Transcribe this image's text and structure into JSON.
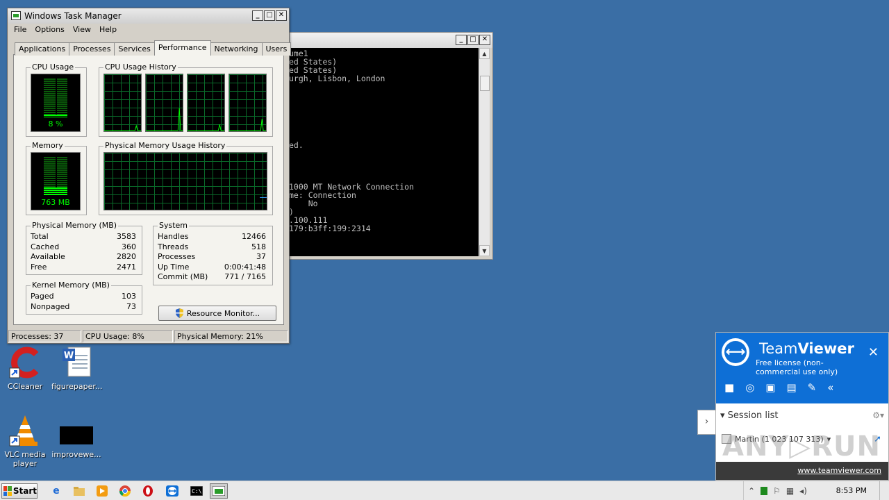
{
  "desktop": {
    "icons": [
      {
        "label": "CCleaner"
      },
      {
        "label": "figurepaper..."
      },
      {
        "label": "VLC media player"
      },
      {
        "label": "improvewe..."
      }
    ]
  },
  "console": {
    "lines": [
      "ume1",
      "ed States)",
      "ed States)",
      "urgh, Lisbon, London",
      "",
      "",
      "",
      "",
      "",
      "",
      "",
      "ed.",
      "",
      "",
      "",
      "",
      "1000 MT Network Connection",
      "me: Connection",
      "    No",
      ")",
      ".100.111",
      "179:b3ff:199:2314"
    ]
  },
  "taskmgr": {
    "title": "Windows Task Manager",
    "menu": [
      "File",
      "Options",
      "View",
      "Help"
    ],
    "tabs": [
      "Applications",
      "Processes",
      "Services",
      "Performance",
      "Networking",
      "Users"
    ],
    "active_tab": "Performance",
    "cpu_usage": {
      "title": "CPU Usage",
      "value": "8 %",
      "level": 0.08
    },
    "cpu_history": {
      "title": "CPU Usage History"
    },
    "memory": {
      "title": "Memory",
      "value": "763 MB",
      "level": 0.21
    },
    "mem_history": {
      "title": "Physical Memory Usage History"
    },
    "physical_memory": {
      "title": "Physical Memory (MB)",
      "rows": [
        {
          "label": "Total",
          "value": "3583"
        },
        {
          "label": "Cached",
          "value": "360"
        },
        {
          "label": "Available",
          "value": "2820"
        },
        {
          "label": "Free",
          "value": "2471"
        }
      ]
    },
    "kernel_memory": {
      "title": "Kernel Memory (MB)",
      "rows": [
        {
          "label": "Paged",
          "value": "103"
        },
        {
          "label": "Nonpaged",
          "value": "73"
        }
      ]
    },
    "system": {
      "title": "System",
      "rows": [
        {
          "label": "Handles",
          "value": "12466"
        },
        {
          "label": "Threads",
          "value": "518"
        },
        {
          "label": "Processes",
          "value": "37"
        },
        {
          "label": "Up Time",
          "value": "0:00:41:48"
        },
        {
          "label": "Commit (MB)",
          "value": "771 / 7165"
        }
      ]
    },
    "resource_monitor_label": "Resource Monitor...",
    "status": {
      "processes": "Processes: 37",
      "cpu": "CPU Usage: 8%",
      "memory": "Physical Memory: 21%"
    }
  },
  "teamviewer": {
    "brand_light": "Team",
    "brand_bold": "Viewer",
    "license": "Free license (non-commercial use only)",
    "session_list": "Session list",
    "session_entry": "Martin (1 023 107 313)",
    "link": "www.teamviewer.com",
    "accent": "#0e6fd6"
  },
  "taskbar": {
    "start_label": "Start",
    "clock": "8:53 PM",
    "apps": [
      "internet-explorer",
      "explorer",
      "media-player",
      "chrome",
      "opera",
      "teamviewer",
      "cmd",
      "task-manager"
    ]
  }
}
